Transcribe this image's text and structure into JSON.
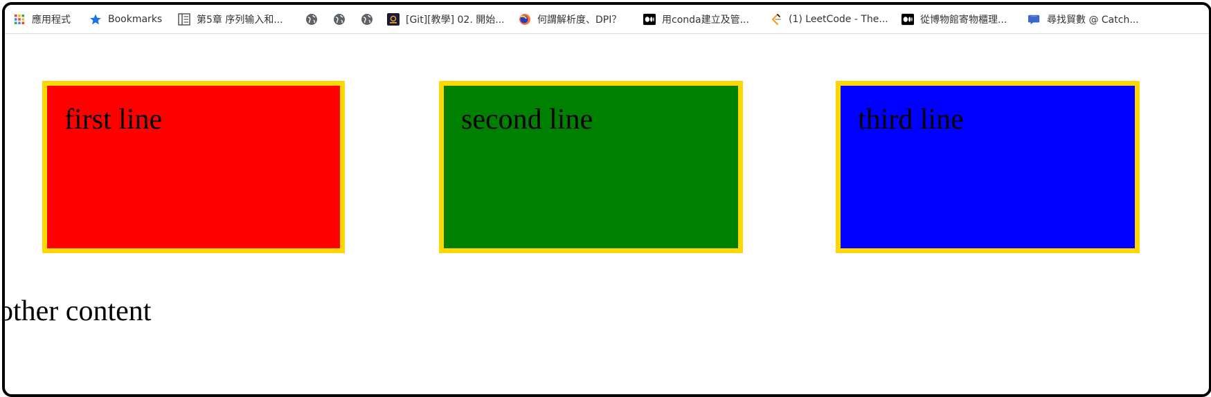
{
  "bookmarks": {
    "apps_label": "應用程式",
    "bookmarks_label": "Bookmarks",
    "items": [
      {
        "label": "第5章 序列输入和..."
      },
      {
        "label": ""
      },
      {
        "label": ""
      },
      {
        "label": ""
      },
      {
        "label": "[Git][教學] 02. 開始..."
      },
      {
        "label": "何謂解析度、DPI？"
      },
      {
        "label": "用conda建立及管..."
      },
      {
        "label": "(1) LeetCode - The..."
      },
      {
        "label": "從博物館寄物櫃理..."
      },
      {
        "label": "尋找貿數 @ Catch..."
      }
    ]
  },
  "boxes": [
    {
      "text": "first line",
      "color": "#ff0000"
    },
    {
      "text": "second line",
      "color": "#008000"
    },
    {
      "text": "third line",
      "color": "#0000ff"
    }
  ],
  "border_color": "#ffd700",
  "other_content": "other content"
}
